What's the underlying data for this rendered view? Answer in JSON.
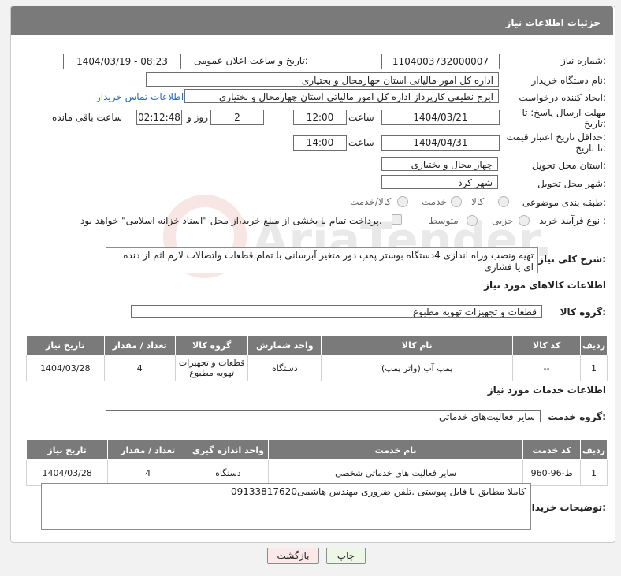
{
  "header": {
    "title": "جزئیات اطلاعات نیاز"
  },
  "fields": {
    "need_number_label": "شماره نیاز:",
    "need_number": "1104003732000007",
    "announce_label": "تاریخ و ساعت اعلان عمومی:",
    "announce_value": "1404/03/19 - 08:23",
    "buyer_org_label": "نام دستگاه خریدار:",
    "buyer_org": "اداره کل امور مالیاتی استان چهارمحال و بختیاری",
    "requester_label": "ایجاد کننده درخواست:",
    "requester": "ایرج نظیفی کارپرداز اداره کل امور مالیاتی استان چهارمحال و بختیاری",
    "contact_link": "اطلاعات تماس خریدار",
    "deadline_label_1": "مهلت ارسال پاسخ: تا",
    "deadline_label_2": "تاریخ:",
    "deadline_date": "1404/03/21",
    "time_word": "ساعت",
    "deadline_time": "12:00",
    "days_value": "2",
    "days_word": "روز و",
    "remaining_time": "02:12:48",
    "remaining_word": "ساعت باقی مانده",
    "price_validity_label_1": "حداقل تاریخ اعتبار قیمت:",
    "price_validity_label_2": "تا تاریخ:",
    "price_validity_date": "1404/04/31",
    "price_validity_time": "14:00",
    "province_label": "استان محل تحویل:",
    "province": "چهار محال و بختیاری",
    "city_label": "شهر محل تحویل:",
    "city": "شهر کرد",
    "category_label": "طبقه بندی موضوعی:",
    "category_options": [
      "کالا",
      "خدمت",
      "کالا/خدمت"
    ],
    "process_label": "نوع فرآیند خرید :",
    "process_options": [
      "جزیی",
      "متوسط"
    ],
    "payment_note": "پرداخت تمام یا بخشی از مبلغ خرید،از محل \"اسناد خزانه اسلامی\" خواهد بود."
  },
  "description": {
    "label": "شرح کلی نیاز:",
    "text": "تهیه ونصب وراه اندازی 4دستگاه بوستر پمپ دور متغیر آبرسانی با تمام قطعات واتصالات لازم اثم از دنده ای یا فشاری"
  },
  "goods": {
    "section_title": "اطلاعات کالاهای مورد نیاز",
    "group_label": "گروه کالا:",
    "group_value": "قطعات و تجهیزات تهویه مطبوع",
    "headers": [
      "ردیف",
      "کد کالا",
      "نام کالا",
      "واحد شمارش",
      "گروه کالا",
      "تعداد / مقدار",
      "تاریخ نیاز"
    ],
    "rows": [
      {
        "row": "1",
        "code": "--",
        "name": "پمپ آب (واتر پمپ)",
        "unit": "دستگاه",
        "group_line1": "قطعات و تجهیزات",
        "group_line2": "تهویه مطبوع",
        "qty": "4",
        "date": "1404/03/28"
      }
    ]
  },
  "services": {
    "section_title": "اطلاعات خدمات مورد نیاز",
    "group_label": "گروه خدمت:",
    "group_value": "سایر فعالیت‌های خدماتی",
    "headers": [
      "ردیف",
      "کد خدمت",
      "نام خدمت",
      "واحد اندازه گیری",
      "تعداد / مقدار",
      "تاریخ نیاز"
    ],
    "rows": [
      {
        "row": "1",
        "code": "ط-96-960",
        "name": "سایر فعالیت های خدماتی شخصی",
        "unit": "دستگاه",
        "qty": "4",
        "date": "1404/03/28"
      }
    ]
  },
  "buyer_notes": {
    "label": "توضیحات خریدار:",
    "text": "کاملا مطابق با فایل پیوستی .تلفن ضروری مهندس هاشمی09133817620"
  },
  "buttons": {
    "print": "چاپ",
    "back": "بازگشت"
  },
  "watermark": {
    "text": "AriaTender.neT"
  }
}
